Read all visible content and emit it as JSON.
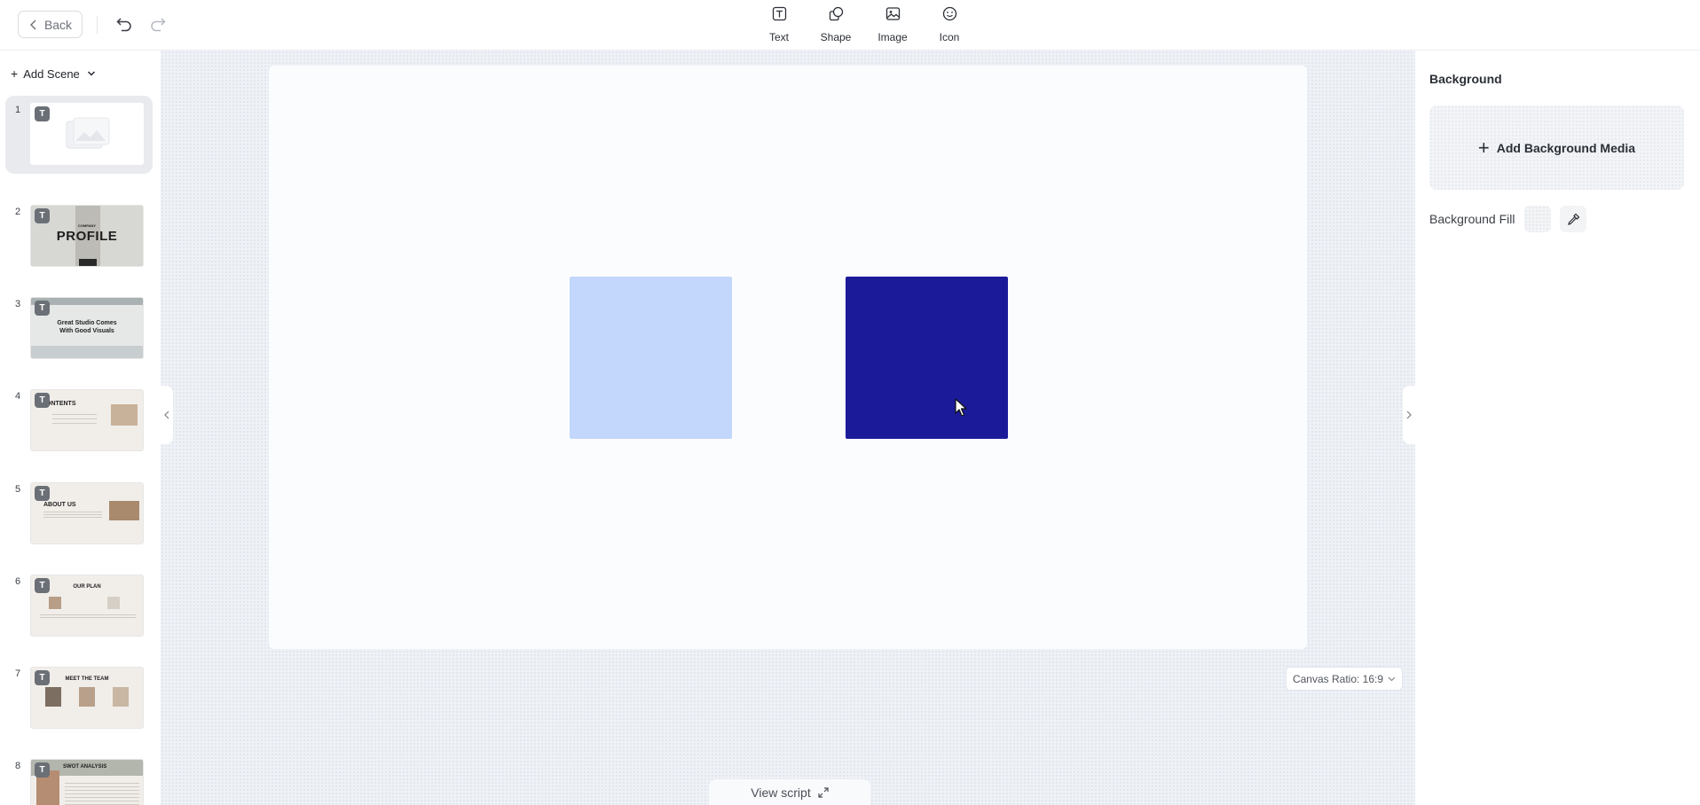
{
  "toolbar": {
    "back_label": "Back",
    "tools": [
      {
        "label": "Text",
        "icon": "text-icon"
      },
      {
        "label": "Shape",
        "icon": "shape-icon"
      },
      {
        "label": "Image",
        "icon": "image-icon"
      },
      {
        "label": "Icon",
        "icon": "smiley-icon"
      }
    ]
  },
  "scenes_panel": {
    "add_scene_label": "Add Scene",
    "scenes": [
      {
        "number": "1",
        "badge": "T",
        "active": true,
        "thumb_text": ""
      },
      {
        "number": "2",
        "badge": "T",
        "active": false,
        "thumb_text": "PROFILE",
        "thumb_caption": "COMPANY"
      },
      {
        "number": "3",
        "badge": "T",
        "active": false,
        "thumb_text": "Great Studio Comes With Good Visuals"
      },
      {
        "number": "4",
        "badge": "T",
        "active": false,
        "thumb_text": "CONTENTS"
      },
      {
        "number": "5",
        "badge": "T",
        "active": false,
        "thumb_text": "ABOUT US"
      },
      {
        "number": "6",
        "badge": "T",
        "active": false,
        "thumb_text": "OUR PLAN"
      },
      {
        "number": "7",
        "badge": "T",
        "active": false,
        "thumb_text": "MEET THE TEAM"
      },
      {
        "number": "8",
        "badge": "T",
        "active": false,
        "thumb_text": "SWOT ANALYSIS"
      }
    ]
  },
  "canvas": {
    "background": "#fbfcfe",
    "shapes": [
      {
        "name": "light-blue-square",
        "color": "#c3d6fb"
      },
      {
        "name": "dark-blue-square",
        "color": "#1b1b9a"
      }
    ],
    "ratio_label": "Canvas Ratio: 16:9",
    "view_script_label": "View script"
  },
  "properties": {
    "title": "Background",
    "add_media_label": "Add Background Media",
    "fill_label": "Background Fill"
  }
}
